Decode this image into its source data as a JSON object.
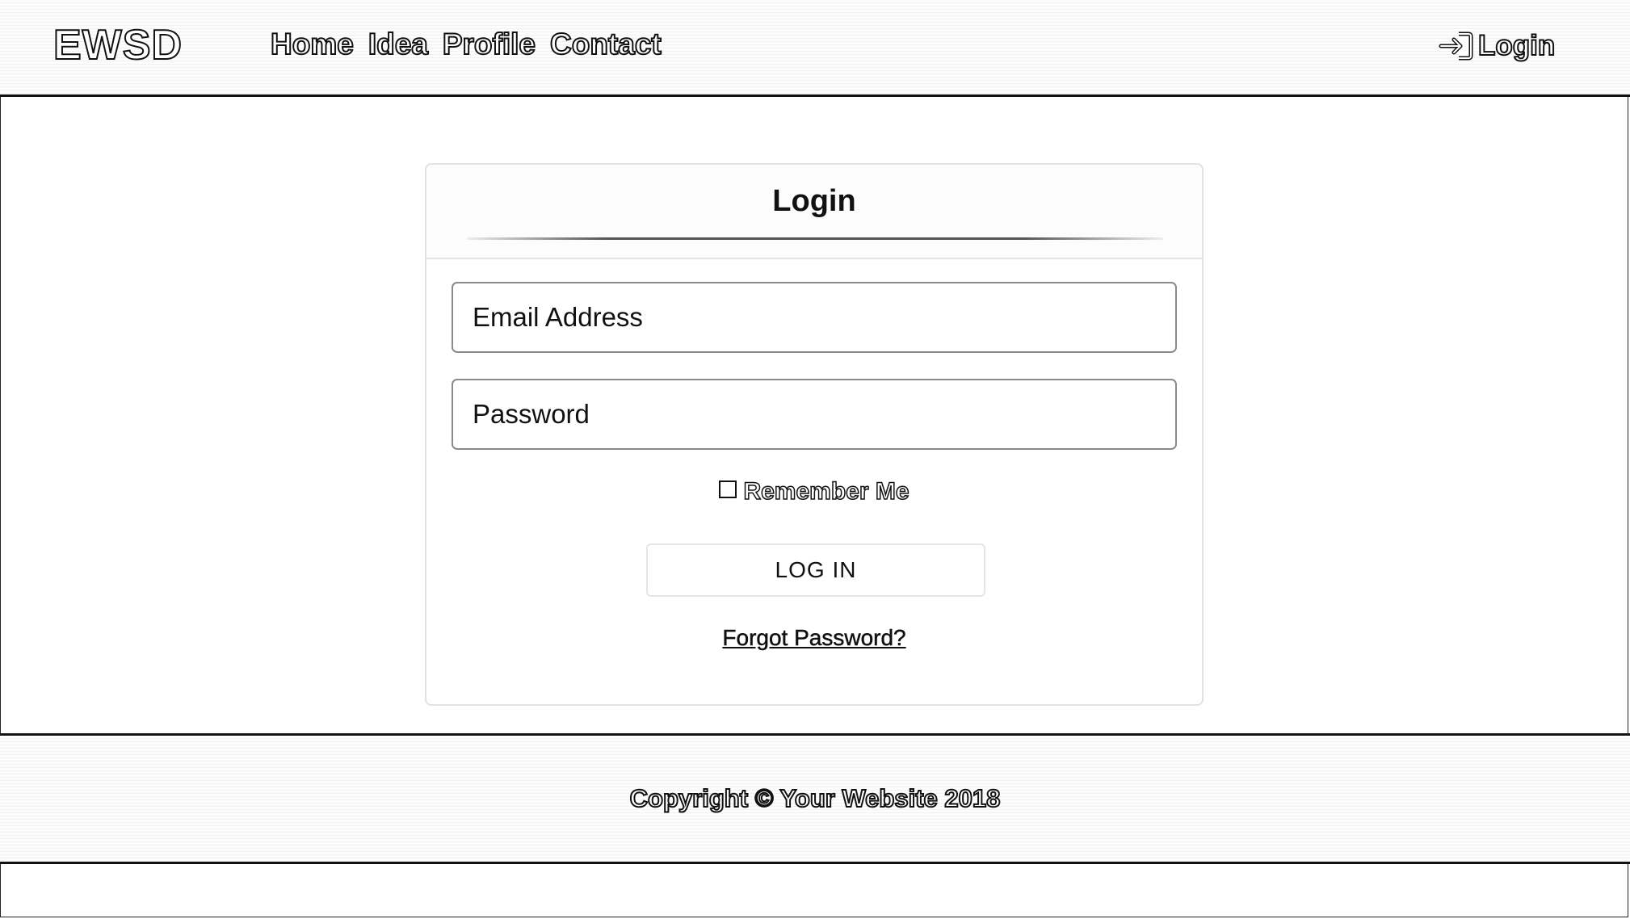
{
  "header": {
    "brand": "EWSD",
    "nav": [
      {
        "label": "Home"
      },
      {
        "label": "Idea"
      },
      {
        "label": "Profile"
      },
      {
        "label": "Contact"
      }
    ],
    "login_label": "Login",
    "login_icon": "sign-in-icon"
  },
  "login_card": {
    "title": "Login",
    "email_placeholder": "Email Address",
    "email_value": "",
    "password_placeholder": "Password",
    "password_value": "",
    "remember_label": "Remember Me",
    "remember_checked": false,
    "submit_label": "LOG IN",
    "forgot_label": "Forgot Password?"
  },
  "footer": {
    "copyright": "Copyright © Your Website 2018"
  }
}
